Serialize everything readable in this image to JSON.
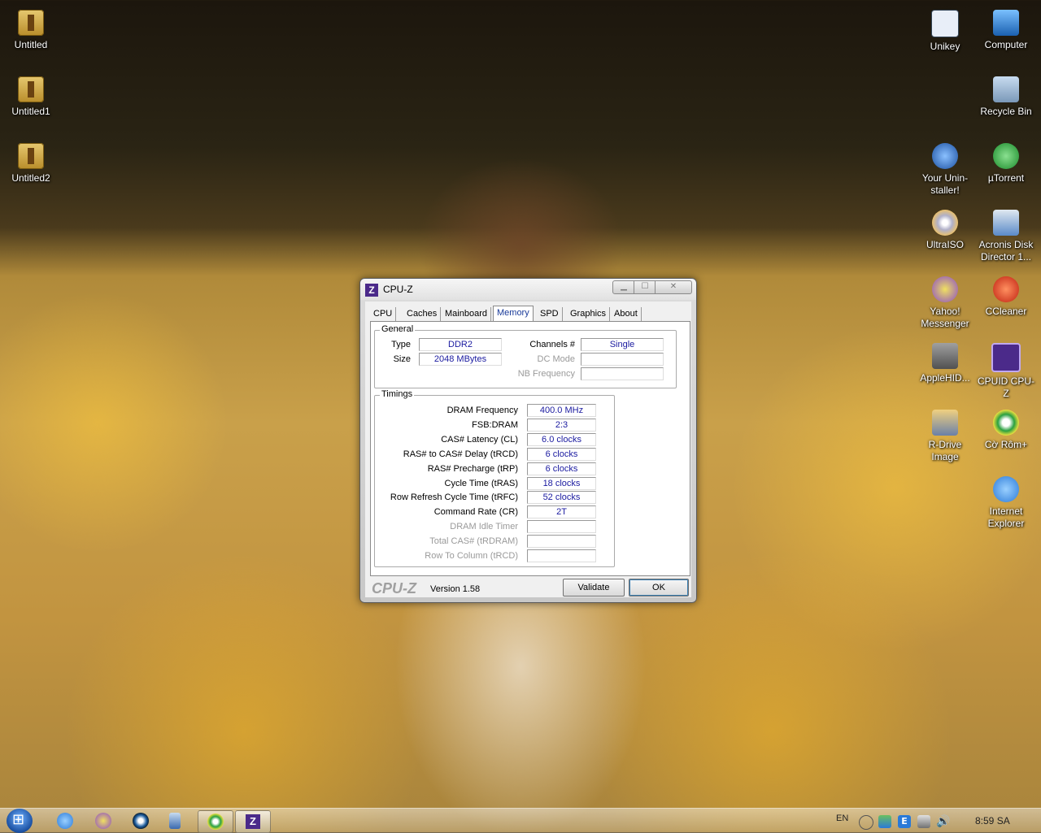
{
  "desktop": {
    "left_icons": [
      {
        "label": "Untitled"
      },
      {
        "label": "Untitled1"
      },
      {
        "label": "Untitled2"
      }
    ],
    "right_icons": [
      {
        "label": "Unikey",
        "color": "#e8eef8"
      },
      {
        "label": "Computer",
        "color": "#4aa0e0"
      },
      {
        "label": "Recycle Bin",
        "color": "#9ab8d8"
      },
      {
        "label": "Your Unin-staller!",
        "color": "#3a78c8"
      },
      {
        "label": "µTorrent",
        "color": "#3aa040"
      },
      {
        "label": "UltraISO",
        "color": "#c8c8d8"
      },
      {
        "label": "Acronis Disk Director 1...",
        "color": "#5a8ac8"
      },
      {
        "label": "Yahoo! Messenger",
        "color": "#8a4ac8"
      },
      {
        "label": "CCleaner",
        "color": "#d04020"
      },
      {
        "label": "AppleHID...",
        "color": "#707070"
      },
      {
        "label": "CPUID CPU-Z",
        "color": "#4b2a8a"
      },
      {
        "label": "R-Drive Image",
        "color": "#6a80a8"
      },
      {
        "label": "Cờ Rôm+",
        "color": "#2aa040"
      },
      {
        "label": "Internet Explorer",
        "color": "#2a7ad8"
      }
    ]
  },
  "window": {
    "title": "CPU-Z",
    "app_icon_letter": "Z",
    "tabs": [
      "CPU",
      "Caches",
      "Mainboard",
      "Memory",
      "SPD",
      "Graphics",
      "About"
    ],
    "active_tab": "Memory",
    "general": {
      "legend": "General",
      "type_label": "Type",
      "type_value": "DDR2",
      "size_label": "Size",
      "size_value": "2048 MBytes",
      "channels_label": "Channels #",
      "channels_value": "Single",
      "dc_mode_label": "DC Mode",
      "dc_mode_value": "",
      "nb_freq_label": "NB Frequency",
      "nb_freq_value": ""
    },
    "timings": {
      "legend": "Timings",
      "rows": [
        {
          "label": "DRAM Frequency",
          "value": "400.0 MHz",
          "enabled": true
        },
        {
          "label": "FSB:DRAM",
          "value": "2:3",
          "enabled": true
        },
        {
          "label": "CAS# Latency (CL)",
          "value": "6.0 clocks",
          "enabled": true
        },
        {
          "label": "RAS# to CAS# Delay (tRCD)",
          "value": "6 clocks",
          "enabled": true
        },
        {
          "label": "RAS# Precharge (tRP)",
          "value": "6 clocks",
          "enabled": true
        },
        {
          "label": "Cycle Time (tRAS)",
          "value": "18 clocks",
          "enabled": true
        },
        {
          "label": "Row Refresh Cycle Time (tRFC)",
          "value": "52 clocks",
          "enabled": true
        },
        {
          "label": "Command Rate (CR)",
          "value": "2T",
          "enabled": true
        },
        {
          "label": "DRAM Idle Timer",
          "value": "",
          "enabled": false
        },
        {
          "label": "Total CAS# (tRDRAM)",
          "value": "",
          "enabled": false
        },
        {
          "label": "Row To Column (tRCD)",
          "value": "",
          "enabled": false
        }
      ]
    },
    "footer": {
      "logo": "CPU-Z",
      "version": "Version 1.58",
      "validate_label": "Validate",
      "ok_label": "OK"
    }
  },
  "taskbar": {
    "language": "EN",
    "clock": "8:59 SA"
  }
}
